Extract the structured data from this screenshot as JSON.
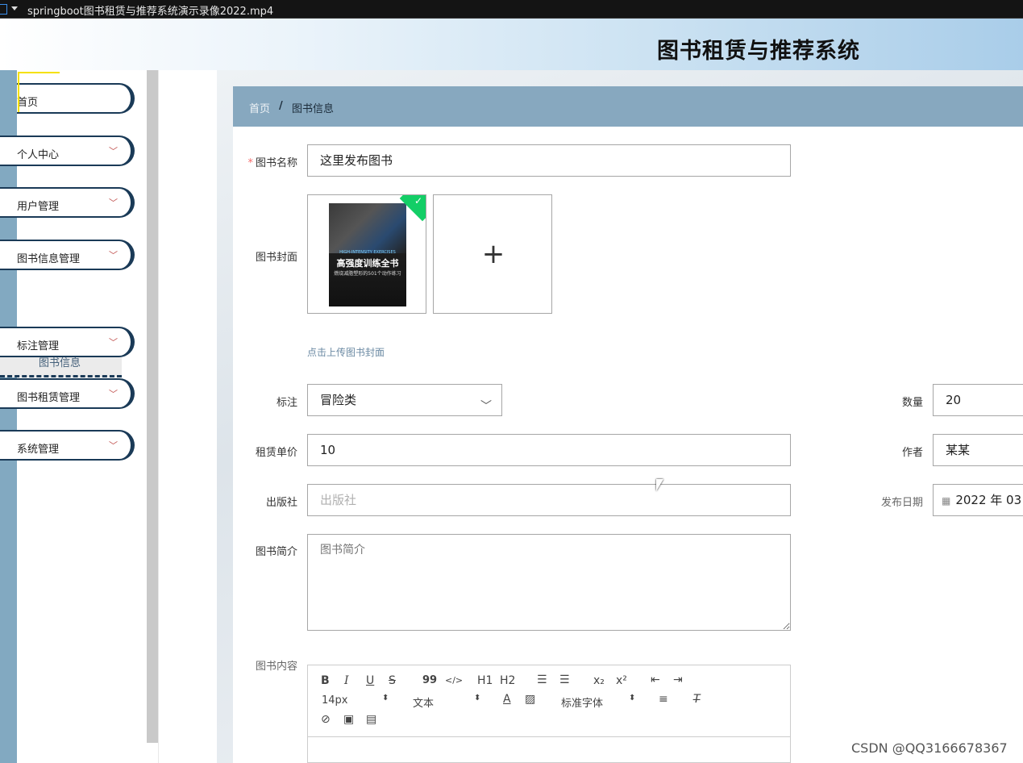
{
  "window": {
    "title": "springboot图书租赁与推荐系统演示录像2022.mp4"
  },
  "header": {
    "site_title": "图书租赁与推荐系统"
  },
  "sidebar": {
    "items": [
      {
        "label": "首页"
      },
      {
        "label": "个人中心"
      },
      {
        "label": "用户管理"
      },
      {
        "label": "图书信息管理"
      },
      {
        "label": "标注管理"
      },
      {
        "label": "图书租赁管理"
      },
      {
        "label": "系统管理"
      }
    ],
    "sub_item": {
      "label": "图书信息"
    },
    "chevron": "chevron-down-icon"
  },
  "breadcrumb": {
    "home": "首页",
    "separator": "/",
    "current": "图书信息"
  },
  "form": {
    "name": {
      "label": "图书名称",
      "value": "这里发布图书"
    },
    "cover": {
      "label": "图书封面",
      "hint": "点击上传图书封面",
      "book_title": "高强度训练全书",
      "book_banner": "HIGH-INTENSITY EXERCISES",
      "book_subtitle": "燃烧减脂塑形的501个动作练习",
      "plus": "+"
    },
    "tag": {
      "label": "标注",
      "value": "冒险类"
    },
    "quantity": {
      "label": "数量",
      "value": "20"
    },
    "price": {
      "label": "租赁单价",
      "value": "10"
    },
    "author": {
      "label": "作者",
      "value": "某某"
    },
    "publisher": {
      "label": "出版社",
      "placeholder": "出版社"
    },
    "publish_date": {
      "label": "发布日期",
      "value": "2022 年 03"
    },
    "intro": {
      "label": "图书简介",
      "placeholder": "图书简介"
    },
    "content": {
      "label": "图书内容",
      "toolbar": {
        "bold": "B",
        "italic": "I",
        "underline": "U",
        "strike": "S",
        "quote": "99",
        "code": "</>",
        "h1": "H1",
        "h2": "H2",
        "sub": "x₂",
        "sup": "x²",
        "size": "14px",
        "format": "文本",
        "font": "标准字体"
      }
    }
  },
  "watermark": "CSDN @QQ3166678367",
  "colors": {
    "nav_border": "#1a3a57",
    "breadcrumb_bg": "#87a8bf",
    "required": "#f56c6c",
    "success": "#13ce66"
  }
}
